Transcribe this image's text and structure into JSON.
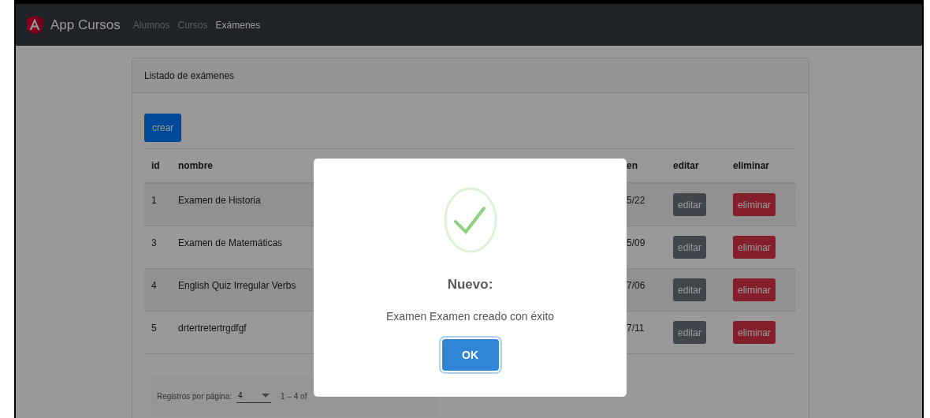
{
  "navbar": {
    "brand": "App Cursos",
    "links": [
      {
        "label": "Alumnos",
        "selected": false
      },
      {
        "label": "Cursos",
        "selected": false
      },
      {
        "label": "Exámenes",
        "selected": true
      }
    ]
  },
  "card": {
    "title": "Listado de exámenes",
    "create_button": "crear",
    "table": {
      "columns": [
        "id",
        "nombre",
        "en",
        "editar",
        "eliminar"
      ],
      "rows": [
        {
          "id": "1",
          "nombre": "Examen de Historia",
          "column_3": "5/22",
          "edit": "editar",
          "delete": "eliminar"
        },
        {
          "id": "3",
          "nombre": "Examen de Matemáticas",
          "column_3": "5/09",
          "edit": "editar",
          "delete": "eliminar"
        },
        {
          "id": "4",
          "nombre": "English Quiz Irregular Verbs",
          "column_3": "7/06",
          "edit": "editar",
          "delete": "eliminar"
        },
        {
          "id": "5",
          "nombre": "drtertretertrgdfgf",
          "column_3": "7/11",
          "edit": "editar",
          "delete": "eliminar"
        }
      ]
    },
    "paginator": {
      "label": "Registros por página:",
      "page_size": "4",
      "range": "1 – 4 of"
    }
  },
  "dialog": {
    "title": "Nuevo:",
    "message": "Examen Examen creado con éxito",
    "confirm_button": "OK"
  }
}
